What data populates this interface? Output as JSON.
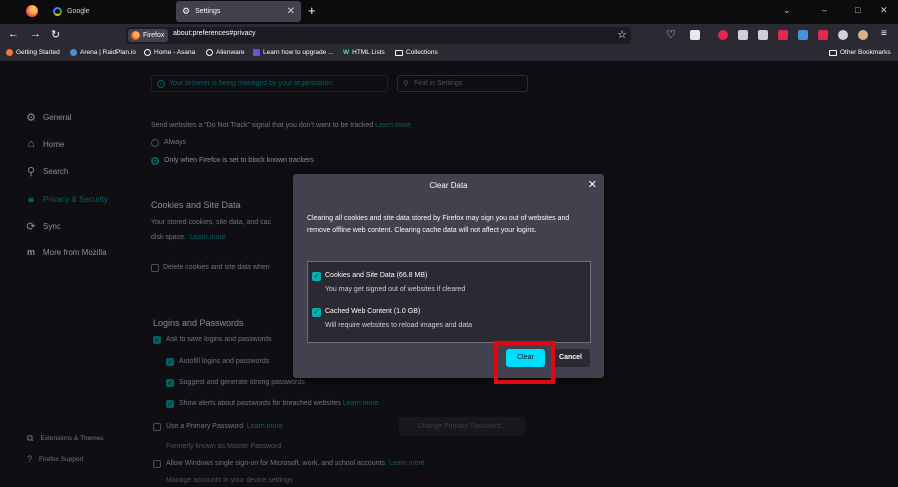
{
  "tabs": [
    {
      "title": "Google"
    },
    {
      "title": "Settings"
    }
  ],
  "window_controls": {
    "list_all_tabs": "⌄",
    "minimize": "–",
    "maximize": "□",
    "close": "✕"
  },
  "navbar": {
    "identity_label": "Firefox",
    "url": "about:preferences#privacy"
  },
  "bookmarks": {
    "items": [
      {
        "label": "Getting Started",
        "color": "#ff7139"
      },
      {
        "label": "Arena | RaidPlan.io",
        "color": "#4a90d9"
      },
      {
        "label": "Home - Asana",
        "color": "#fbfbfe"
      },
      {
        "label": "Alienware",
        "color": "#fbfbfe"
      },
      {
        "label": "Learn how to upgrade ...",
        "color": "#5b5bd6"
      },
      {
        "label": "HTML Lists",
        "color": "#3fe1b0"
      },
      {
        "label": "Collections",
        "color": "#fbfbfe"
      }
    ],
    "other": "Other Bookmarks"
  },
  "settings": {
    "managed_notice": "Your browser is being managed by your organization.",
    "find_placeholder": "Find in Settings",
    "sidebar": [
      {
        "label": "General",
        "icon": "gear-icon"
      },
      {
        "label": "Home",
        "icon": "home-icon"
      },
      {
        "label": "Search",
        "icon": "search-icon"
      },
      {
        "label": "Privacy & Security",
        "icon": "lock-icon"
      },
      {
        "label": "Sync",
        "icon": "sync-icon"
      },
      {
        "label": "More from Mozilla",
        "icon": "mozilla-icon"
      }
    ],
    "sidebar_bottom": [
      {
        "label": "Extensions & Themes",
        "icon": "puzzle-icon"
      },
      {
        "label": "Firefox Support",
        "icon": "help-icon"
      }
    ],
    "dnt": {
      "text": "Send websites a “Do Not Track” signal that you don’t want to be tracked",
      "learn_more": "Learn more",
      "always": "Always",
      "only_when": "Only when Firefox is set to block known trackers"
    },
    "cookies": {
      "heading": "Cookies and Site Data",
      "desc_line1": "Your stored cookies, site data, and cac",
      "desc_line2": "disk space.",
      "learn_more": "Learn more",
      "delete_on_close": "Delete cookies and site data when"
    },
    "logins": {
      "heading": "Logins and Passwords",
      "ask_to_save": "Ask to save logins and passwords",
      "autofill": "Autofill logins and passwords",
      "suggest": "Suggest and generate strong passwords",
      "breach_alerts": "Show alerts about passwords for breached websites",
      "learn_more": "Learn more",
      "primary_password": "Use a Primary Password",
      "primary_learn_more": "Learn more",
      "change_primary": "Change Primary Password...",
      "formerly": "Formerly known as Master Password",
      "windows_sso": "Allow Windows single sign-on for Microsoft, work, and school accounts",
      "sso_learn_more": "Learn more",
      "manage_accounts": "Manage accounts in your device settings"
    }
  },
  "dialog": {
    "title": "Clear Data",
    "description": "Clearing all cookies and site data stored by Firefox may sign you out of websites and remove offline web content. Clearing cache data will not affect your logins.",
    "options": [
      {
        "title": "Cookies and Site Data (66.8 MB)",
        "subtitle": "You may get signed out of websites if cleared",
        "checked": true
      },
      {
        "title": "Cached Web Content (1.0 GB)",
        "subtitle": "Will require websites to reload images and data",
        "checked": true
      }
    ],
    "clear_label": "Clear",
    "cancel_label": "Cancel",
    "accent_color": "#00ddff"
  },
  "annotation": {
    "highlight_color": "#e30613"
  }
}
